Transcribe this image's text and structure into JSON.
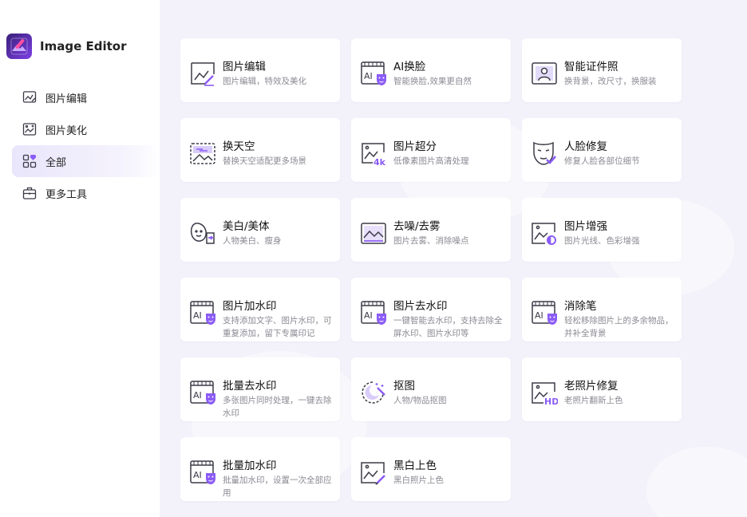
{
  "app": {
    "name": "Image Editor"
  },
  "nav": [
    {
      "label": "图片编辑",
      "icon": "image-edit-icon",
      "active": false
    },
    {
      "label": "图片美化",
      "icon": "image-beautify-icon",
      "active": false
    },
    {
      "label": "全部",
      "icon": "all-apps-icon",
      "active": true
    },
    {
      "label": "更多工具",
      "icon": "toolbox-icon",
      "active": false
    }
  ],
  "tools": [
    {
      "title": "图片编辑",
      "desc": "图片编辑，特效及美化",
      "icon": "image-edit-icon"
    },
    {
      "title": "AI换脸",
      "desc": "智能换脸,效果更自然",
      "icon": "ai-face-swap-icon"
    },
    {
      "title": "智能证件照",
      "desc": "换背景，改尺寸，换服装",
      "icon": "id-photo-icon"
    },
    {
      "title": "换天空",
      "desc": "替换天空适配更多场景",
      "icon": "sky-replace-icon"
    },
    {
      "title": "图片超分",
      "desc": "低像素图片高清处理",
      "icon": "super-resolution-4k-icon"
    },
    {
      "title": "人脸修复",
      "desc": "修复人脸各部位细节",
      "icon": "face-repair-icon"
    },
    {
      "title": "美白/美体",
      "desc": "人物美白、瘦身",
      "icon": "whitening-slimming-icon"
    },
    {
      "title": "去噪/去雾",
      "desc": "图片去雾、消除噪点",
      "icon": "denoise-dehaze-icon"
    },
    {
      "title": "图片增强",
      "desc": "图片光线、色彩增强",
      "icon": "image-enhance-icon"
    },
    {
      "title": "图片加水印",
      "desc": "支持添加文字、图片水印，可重复添加，留下专属印记",
      "icon": "ai-watermark-add-icon"
    },
    {
      "title": "图片去水印",
      "desc": "一键智能去水印，支持去除全屏水印、图片水印等",
      "icon": "ai-watermark-remove-icon"
    },
    {
      "title": "消除笔",
      "desc": "轻松移除图片上的多余物品，并补全背景",
      "icon": "ai-eraser-icon"
    },
    {
      "title": "批量去水印",
      "desc": "多张图片同时处理，一键去除水印",
      "icon": "ai-batch-watermark-remove-icon"
    },
    {
      "title": "抠图",
      "desc": "人物/物品抠图",
      "icon": "cutout-icon"
    },
    {
      "title": "老照片修复",
      "desc": "老照片翻新上色",
      "icon": "old-photo-hd-icon"
    },
    {
      "title": "批量加水印",
      "desc": "批量加水印，设置一次全部应用",
      "icon": "ai-batch-watermark-add-icon"
    },
    {
      "title": "黑白上色",
      "desc": "黑白照片上色",
      "icon": "colorize-icon"
    }
  ],
  "colors": {
    "accent": "#8b5cf6",
    "icon_stroke": "#3b3b48",
    "active_nav_bg": "#ebe7fb",
    "page_bg": "#f3f2fa"
  }
}
